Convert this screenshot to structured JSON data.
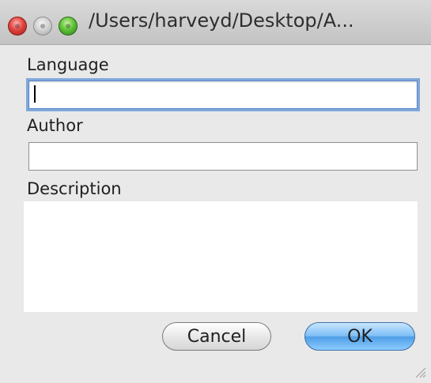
{
  "window": {
    "title": "/Users/harveyd/Desktop/A...",
    "controls": [
      "close-icon",
      "minimize-icon",
      "zoom-icon"
    ]
  },
  "form": {
    "language": {
      "label": "Language",
      "value": "",
      "focused": true
    },
    "author": {
      "label": "Author",
      "value": ""
    },
    "description": {
      "label": "Description",
      "value": ""
    }
  },
  "buttons": {
    "cancel": "Cancel",
    "ok": "OK"
  },
  "colors": {
    "focus_ring": "#7fa8db",
    "default_button": "#5aa6ee",
    "close": "#e0453f",
    "zoom": "#5ec335"
  }
}
